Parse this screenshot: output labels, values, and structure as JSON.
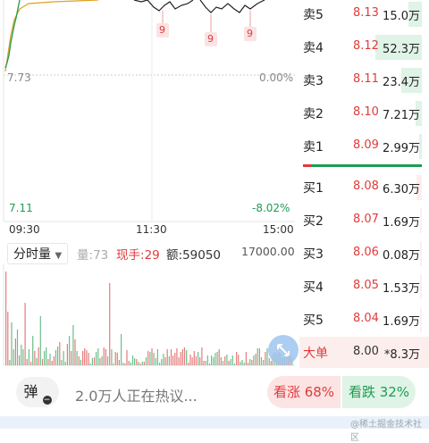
{
  "chart": {
    "price_high_left": "7.73",
    "change_high_right": "0.00%",
    "price_low_left": "7.11",
    "change_low_right": "-8.02%",
    "time_start": "09:30",
    "time_mid": "11:30",
    "time_end": "15:00",
    "markers": [
      "9",
      "9",
      "9"
    ]
  },
  "volume_header": {
    "tab_label": "分时量",
    "vol_prefix": "量:",
    "vol_value": "73",
    "hand_prefix": "现手:",
    "hand_value": "29",
    "amount_prefix": "额:",
    "amount_value": "59050",
    "scale_max": "17000.00"
  },
  "order_book": {
    "asks": [
      {
        "side": "卖5",
        "price": "8.13",
        "volume": "15.0万",
        "fill": 0.29
      },
      {
        "side": "卖4",
        "price": "8.12",
        "volume": "52.3万",
        "fill": 1.0
      },
      {
        "side": "卖3",
        "price": "8.11",
        "volume": "23.4万",
        "fill": 0.45
      },
      {
        "side": "卖2",
        "price": "8.10",
        "volume": "7.21万",
        "fill": 0.14
      },
      {
        "side": "卖1",
        "price": "8.09",
        "volume": "2.99万",
        "fill": 0.06
      }
    ],
    "bids": [
      {
        "side": "买1",
        "price": "8.08",
        "volume": "6.30万",
        "fill": 0.12
      },
      {
        "side": "买2",
        "price": "8.07",
        "volume": "1.69万",
        "fill": 0.03
      },
      {
        "side": "买3",
        "price": "8.06",
        "volume": "0.08万",
        "fill": 0.01
      },
      {
        "side": "买4",
        "price": "8.05",
        "volume": "1.53万",
        "fill": 0.03
      },
      {
        "side": "买5",
        "price": "8.04",
        "volume": "1.69万",
        "fill": 0.03
      }
    ],
    "big_order": {
      "label": "大单",
      "price": "8.00",
      "volume": "*8.3万"
    }
  },
  "bottom": {
    "bounce_label": "弹",
    "heat_text": "2.0万人正在热议...",
    "bull_label": "看涨 68%",
    "bear_label": "看跌 32%"
  },
  "watermark": "@稀土掘金技术社区",
  "colors": {
    "up": "#e23a3a",
    "down": "#1f9b52",
    "avg": "#e0a020"
  }
}
